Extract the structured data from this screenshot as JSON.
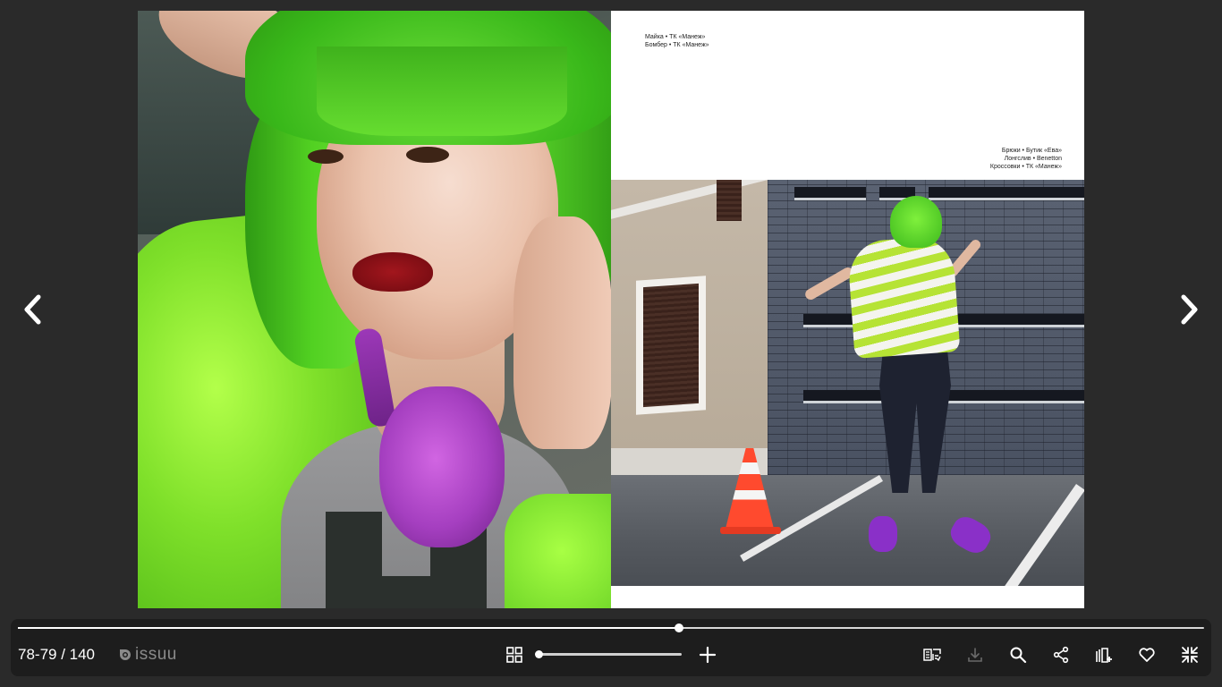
{
  "viewer": {
    "page_indicator": "78-79 / 140",
    "brand_name": "issuu",
    "progress": 0.557,
    "zoom_level": 0
  },
  "navigation": {
    "prev_icon": "chevron-left-icon",
    "next_icon": "chevron-right-icon"
  },
  "spread": {
    "right_page": {
      "caption_top": [
        "Майка • ТК «Манеж»",
        "Бомбер • ТК «Манеж»"
      ],
      "caption_right": [
        "Брюки • Бутик «Ева»",
        "Лонгслив • Benetton",
        "Кроссовки • ТК «Манеж»"
      ]
    }
  },
  "toolbar": {
    "icons": {
      "grid": "grid-icon",
      "zoom_in": "plus-icon",
      "reader_mode": "reader-mode-icon",
      "download": "download-icon",
      "search": "search-icon",
      "share": "share-icon",
      "add_to_stack": "add-to-stack-icon",
      "like": "heart-icon",
      "exit_fullscreen": "exit-fullscreen-icon"
    }
  },
  "colors": {
    "background": "#2a2a2a",
    "toolbar": "#1d1d1d",
    "accent": "#ffffff",
    "brand_muted": "#8a8a8a",
    "disabled_icon": "#6a6a6a"
  }
}
